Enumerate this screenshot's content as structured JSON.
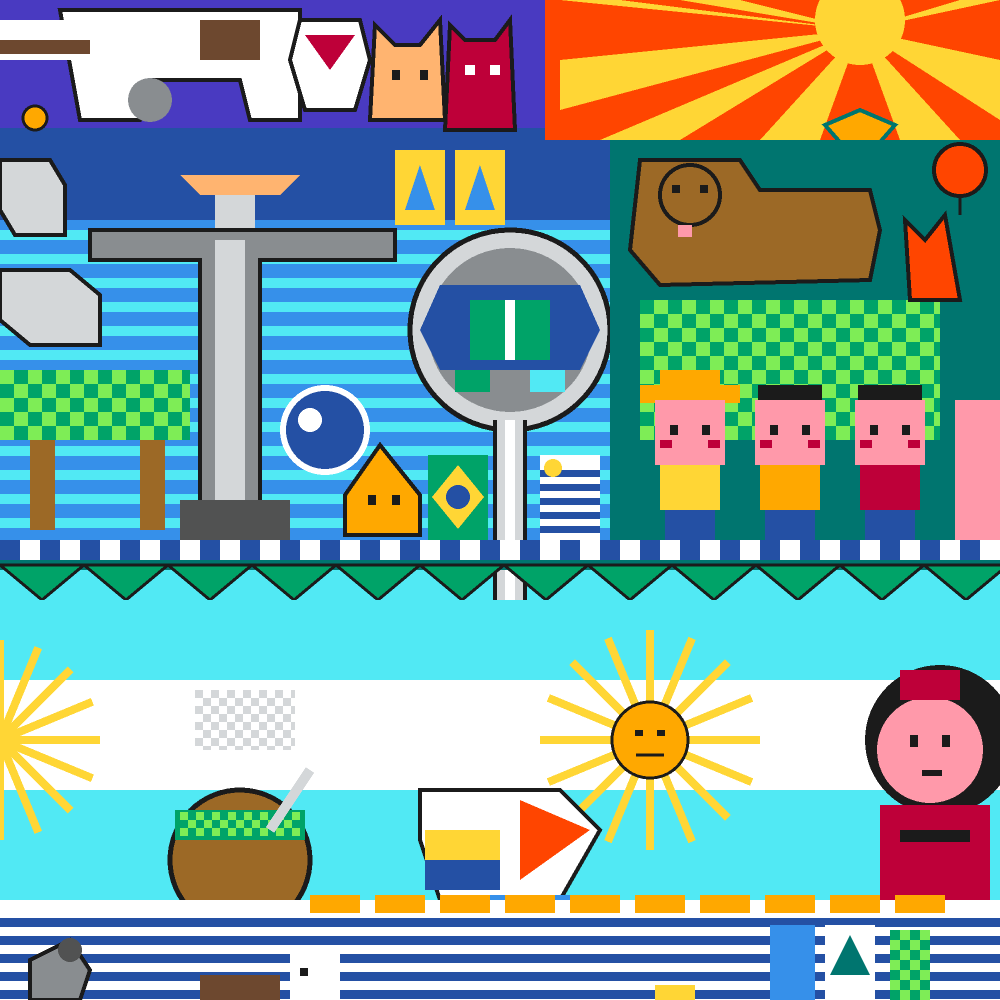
{
  "scene": {
    "palette": {
      "black": "#1b1b1b",
      "white": "#ffffff",
      "light_gray": "#d4d7d9",
      "gray": "#898d90",
      "dark_gray": "#515252",
      "cyan": "#51e9f4",
      "light_blue": "#3690ea",
      "blue": "#2450a4",
      "indigo": "#493ac1",
      "yellow": "#ffd635",
      "orange": "#ff4500",
      "light_orange": "#ffa800",
      "red": "#be0039",
      "pink": "#ff99aa",
      "brown": "#9c6926",
      "dark_brown": "#6d482f",
      "green": "#00a368",
      "dark_green": "#00756f",
      "light_green": "#7eed56",
      "beige": "#ffb470"
    },
    "sections": [
      "top-left-characters-strip",
      "top-right-sun-rays-banner",
      "rio-christ-statue-panel",
      "stadium-emblem",
      "brown-capybara-corner",
      "kid-characters-row",
      "argentina-flag-field",
      "mate-cup",
      "sun-of-may",
      "girl-character",
      "uruguay-flag-strip",
      "bottom-characters-row"
    ]
  }
}
